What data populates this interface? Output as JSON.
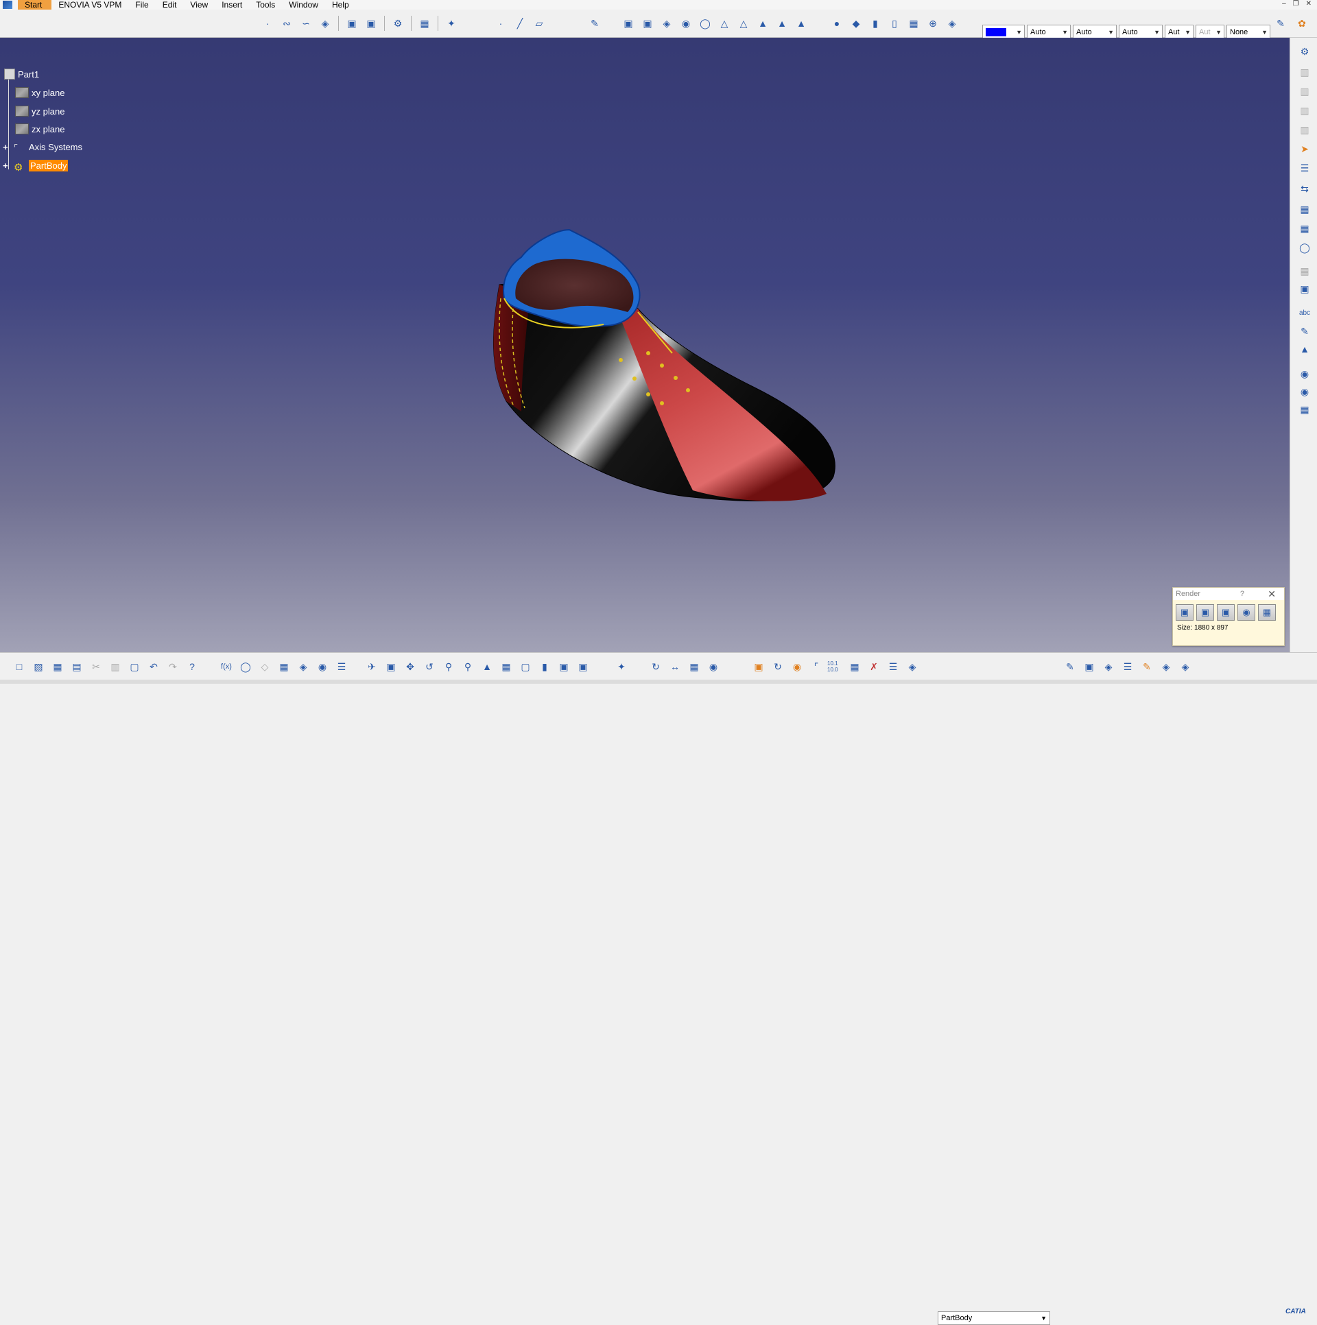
{
  "menu": {
    "items": [
      "Start",
      "ENOVIA V5 VPM",
      "File",
      "Edit",
      "View",
      "Insert",
      "Tools",
      "Window",
      "Help"
    ]
  },
  "toolbar_top": {
    "color_value": "#0000ff",
    "combos": [
      "Auto",
      "Auto",
      "Auto",
      "Aut",
      "Aut",
      "None"
    ]
  },
  "tree": {
    "root": "Part1",
    "items": [
      "xy plane",
      "yz plane",
      "zx plane",
      "Axis Systems",
      "PartBody"
    ]
  },
  "render_panel": {
    "title": "Render",
    "help": "?",
    "size_label": "Size: 1880 x 897"
  },
  "bottom_toolbar": {
    "current_body": "PartBody",
    "scale_label": "10.1 10.0"
  },
  "logo": "CATIA",
  "colors": {
    "viewport_top": "#363a73",
    "viewport_bottom": "#a2a2b6",
    "selection": "#ff8a00",
    "shoe_black": "#0a0a0a",
    "shoe_red": "#b03030",
    "shoe_collar_blue": "#1e6ad0",
    "stitch_yellow": "#e8d020"
  }
}
